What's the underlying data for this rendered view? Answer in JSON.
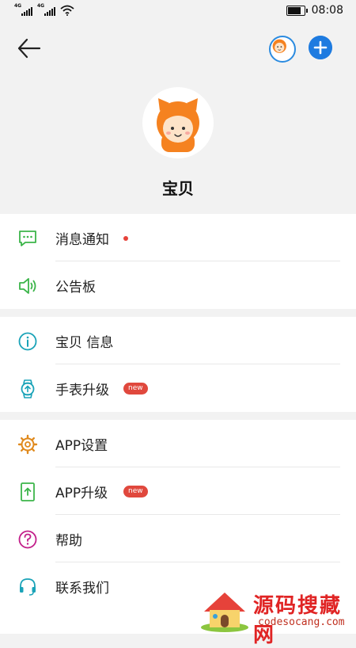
{
  "status_bar": {
    "network1": "4G",
    "network2": "4G",
    "time": "08:08",
    "battery_level": 0.9
  },
  "header": {
    "back_icon": "arrow-left-icon",
    "avatar_icon": "baby-avatar-icon",
    "add_icon": "plus-circle-icon",
    "accent_color": "#1e7be0"
  },
  "profile": {
    "name": "宝贝"
  },
  "sections": [
    {
      "items": [
        {
          "label": "消息通知",
          "icon": "message-icon",
          "icon_color": "#3cb54a",
          "has_dot": true
        },
        {
          "label": "公告板",
          "icon": "speaker-icon",
          "icon_color": "#3cb54a"
        }
      ]
    },
    {
      "items": [
        {
          "label": "宝贝 信息",
          "icon": "info-icon",
          "icon_color": "#1aa3b8"
        },
        {
          "label": "手表升级",
          "icon": "watch-upgrade-icon",
          "icon_color": "#1aa3b8",
          "badge": "new"
        }
      ]
    },
    {
      "items": [
        {
          "label": "APP设置",
          "icon": "gear-icon",
          "icon_color": "#e08a1e"
        },
        {
          "label": "APP升级",
          "icon": "phone-upgrade-icon",
          "icon_color": "#3cb54a",
          "badge": "new"
        },
        {
          "label": "帮助",
          "icon": "question-icon",
          "icon_color": "#c21f8a"
        },
        {
          "label": "联系我们",
          "icon": "headset-icon",
          "icon_color": "#1aa3b8"
        }
      ]
    }
  ],
  "watermark": {
    "title": "源码搜藏网",
    "url": "codesocang.com"
  }
}
